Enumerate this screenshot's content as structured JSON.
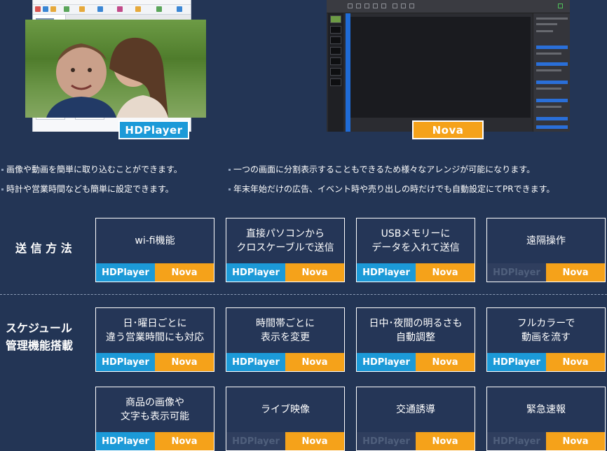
{
  "screenshots": {
    "hdplayer_label": "HDPlayer",
    "nova_label": "Nova"
  },
  "bullets": [
    "画像や動画を簡単に取り込むことができます。",
    "時計や営業時間なども簡単に設定できます。",
    "一つの画面に分割表示することもできるため様々なアレンジが可能になります。",
    "年末年始だけの広告、イベント時や売り出しの時だけでも自動設定にてPRできます。"
  ],
  "sections": {
    "transmission": {
      "title": "送 信 方 法",
      "cards": [
        {
          "text": "wi-fi機能",
          "hdplayer": "HDPlayer",
          "hdplayer_supported": true,
          "nova": "Nova"
        },
        {
          "text": "直接パソコンから\nクロスケーブルで送信",
          "hdplayer": "HDPlayer",
          "hdplayer_supported": true,
          "nova": "Nova"
        },
        {
          "text": "USBメモリーに\nデータを入れて送信",
          "hdplayer": "HDPlayer",
          "hdplayer_supported": true,
          "nova": "Nova"
        },
        {
          "text": "遠隔操作",
          "hdplayer": "HDPlayer",
          "hdplayer_supported": false,
          "nova": "Nova"
        }
      ]
    },
    "schedule": {
      "title_line1": "スケジュール",
      "title_line2": "管理機能搭載",
      "cards": [
        {
          "text": "日･曜日ごとに\n違う営業時間にも対応",
          "hdplayer": "HDPlayer",
          "hdplayer_supported": true,
          "nova": "Nova"
        },
        {
          "text": "時間帯ごとに\n表示を変更",
          "hdplayer": "HDPlayer",
          "hdplayer_supported": true,
          "nova": "Nova"
        },
        {
          "text": "日中･夜間の明るさも\n自動調整",
          "hdplayer": "HDPlayer",
          "hdplayer_supported": true,
          "nova": "Nova"
        },
        {
          "text": "フルカラーで\n動画を流す",
          "hdplayer": "HDPlayer",
          "hdplayer_supported": true,
          "nova": "Nova"
        },
        {
          "text": "商品の画像や\n文字も表示可能",
          "hdplayer": "HDPlayer",
          "hdplayer_supported": true,
          "nova": "Nova"
        },
        {
          "text": "ライブ映像",
          "hdplayer": "HDPlayer",
          "hdplayer_supported": false,
          "nova": "Nova"
        },
        {
          "text": "交通誘導",
          "hdplayer": "HDPlayer",
          "hdplayer_supported": false,
          "nova": "Nova"
        },
        {
          "text": "緊急速報",
          "hdplayer": "HDPlayer",
          "hdplayer_supported": false,
          "nova": "Nova"
        }
      ]
    }
  },
  "colors": {
    "background": "#233555",
    "hdplayer_blue": "#1c9ad8",
    "nova_orange": "#f5a21a",
    "unsupported": "#2f3e5e"
  }
}
